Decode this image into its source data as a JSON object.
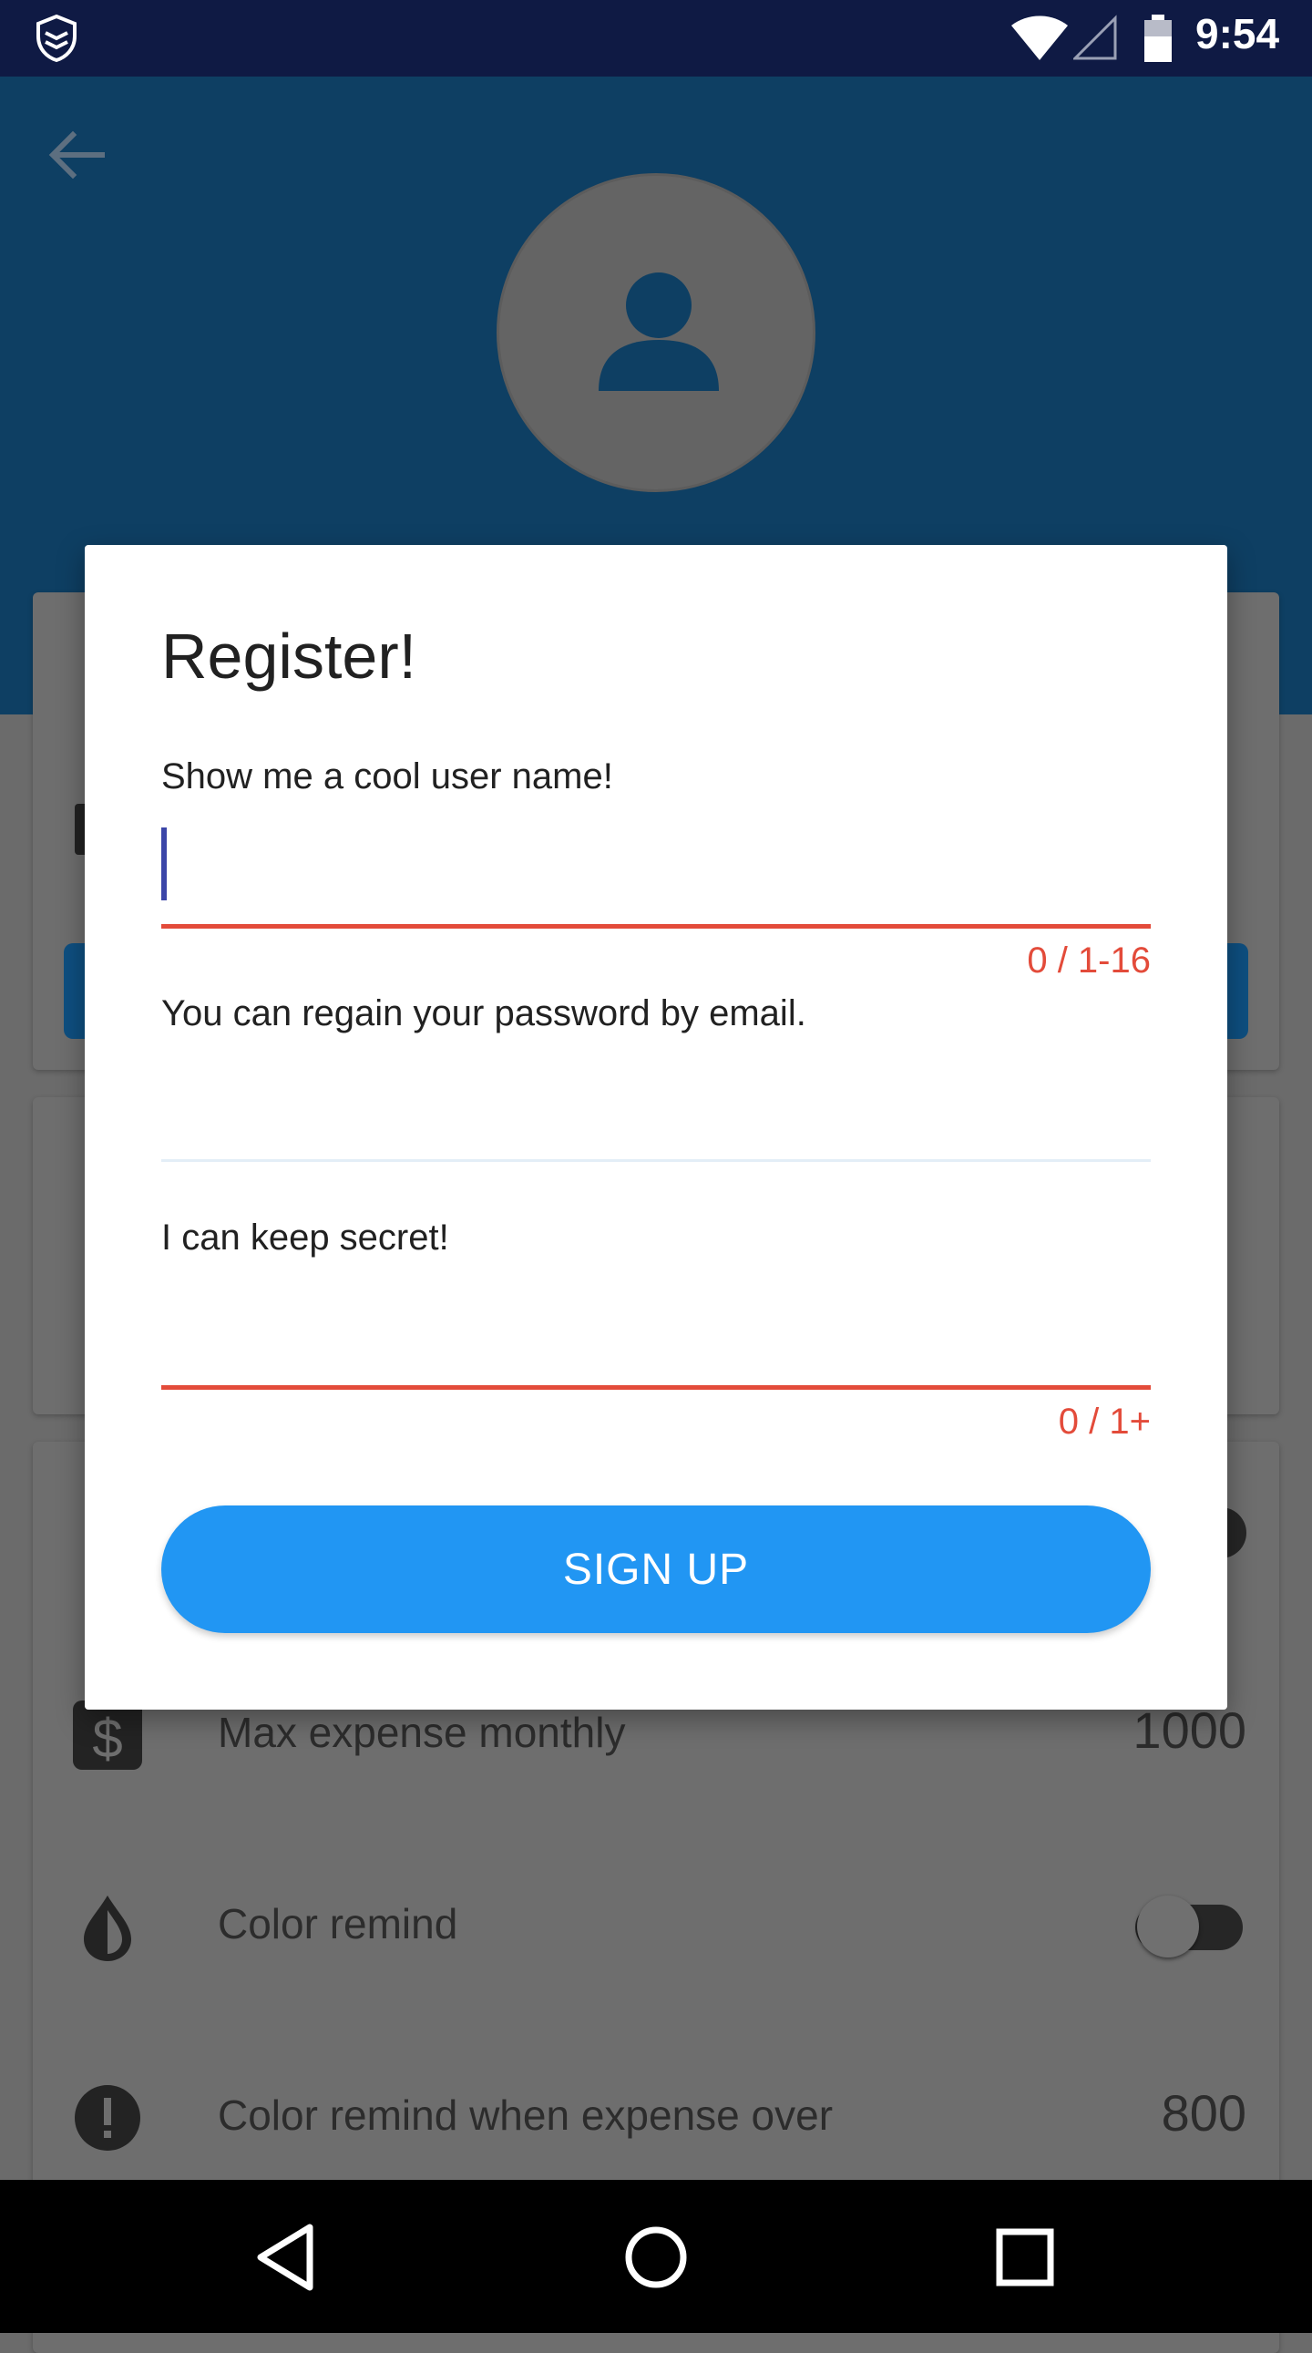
{
  "status_bar": {
    "time": "9:54",
    "icons": [
      "app-shield-icon",
      "wifi-icon",
      "cell-signal-icon",
      "battery-icon"
    ]
  },
  "background_screen": {
    "back_icon": "arrow-left-icon",
    "avatar_icon": "person-icon",
    "settings": [
      {
        "icon": "dollar-icon",
        "label": "Max expense monthly",
        "value": "1000"
      },
      {
        "icon": "drop-icon",
        "label": "Color remind",
        "toggle": "off"
      },
      {
        "icon": "exclamation-icon",
        "label": "Color remind when expense over",
        "value": "800"
      }
    ]
  },
  "dialog": {
    "title": "Register!",
    "username": {
      "label": "Show me a cool user name!",
      "value": "",
      "counter": "0 / 1-16"
    },
    "email": {
      "label": "You can regain your password by email.",
      "value": ""
    },
    "password": {
      "label": "I can keep secret!",
      "value": "",
      "counter": "0 / 1+"
    },
    "submit_label": "SIGN UP"
  },
  "nav_bar": {
    "icons": [
      "back-triangle-icon",
      "home-circle-icon",
      "recents-square-icon"
    ]
  },
  "colors": {
    "accent": "#2196f3",
    "error": "#e34b3a",
    "cursor": "#3b46a8",
    "status_bar": "#0f1a44"
  }
}
